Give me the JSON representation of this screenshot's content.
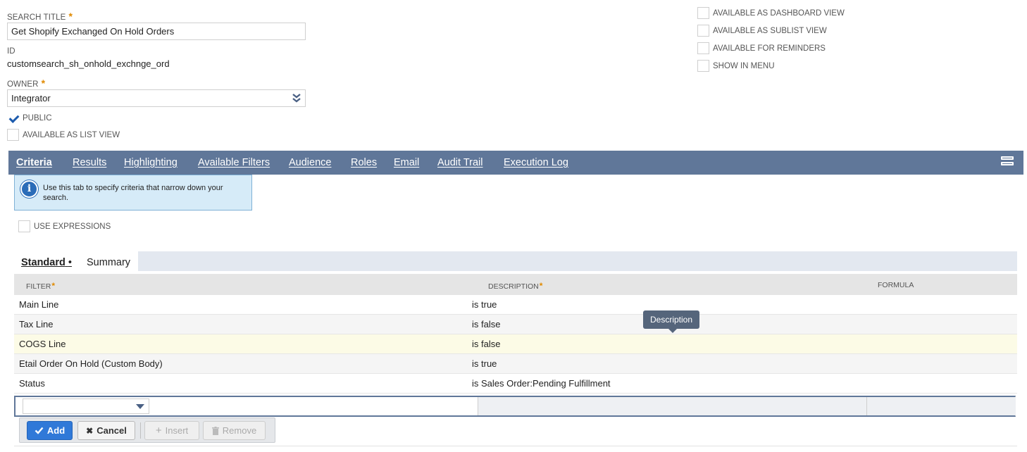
{
  "form": {
    "search_title_label": "SEARCH TITLE",
    "required_mark": "*",
    "search_title_value": "Get Shopify Exchanged On Hold Orders",
    "id_label": "ID",
    "id_value": "customsearch_sh_onhold_exchnge_ord",
    "owner_label": "OWNER",
    "owner_value": "Integrator",
    "public_label": "PUBLIC",
    "public_checked": true,
    "list_view_label": "AVAILABLE AS LIST VIEW",
    "right_options": [
      "AVAILABLE AS DASHBOARD VIEW",
      "AVAILABLE AS SUBLIST VIEW",
      "AVAILABLE FOR REMINDERS",
      "SHOW IN MENU"
    ]
  },
  "tabs": [
    "Criteria",
    "Results",
    "Highlighting",
    "Available Filters",
    "Audience",
    "Roles",
    "Email",
    "Audit Trail",
    "Execution Log"
  ],
  "info_message": "Use this tab to specify criteria that narrow down your search.",
  "use_expressions_label": "USE EXPRESSIONS",
  "subtabs": {
    "standard": "Standard",
    "dot": "•",
    "summary": "Summary"
  },
  "grid": {
    "headers": [
      "FILTER",
      "DESCRIPTION",
      "FORMULA"
    ],
    "rows": [
      {
        "filter": "Main Line",
        "description": "is true"
      },
      {
        "filter": "Tax Line",
        "description": "is false"
      },
      {
        "filter": "COGS Line",
        "description": "is false"
      },
      {
        "filter": "Etail Order On Hold (Custom Body)",
        "description": "is true"
      },
      {
        "filter": "Status",
        "description": "is Sales Order:Pending Fulfillment"
      }
    ]
  },
  "tooltip": "Description",
  "buttons": {
    "add": "Add",
    "cancel": "Cancel",
    "insert": "Insert",
    "remove": "Remove"
  },
  "colors": {
    "tabbar": "#607799",
    "accent": "#3079d8",
    "required": "#e08a00",
    "highlight_row": "#fcfbe6"
  }
}
